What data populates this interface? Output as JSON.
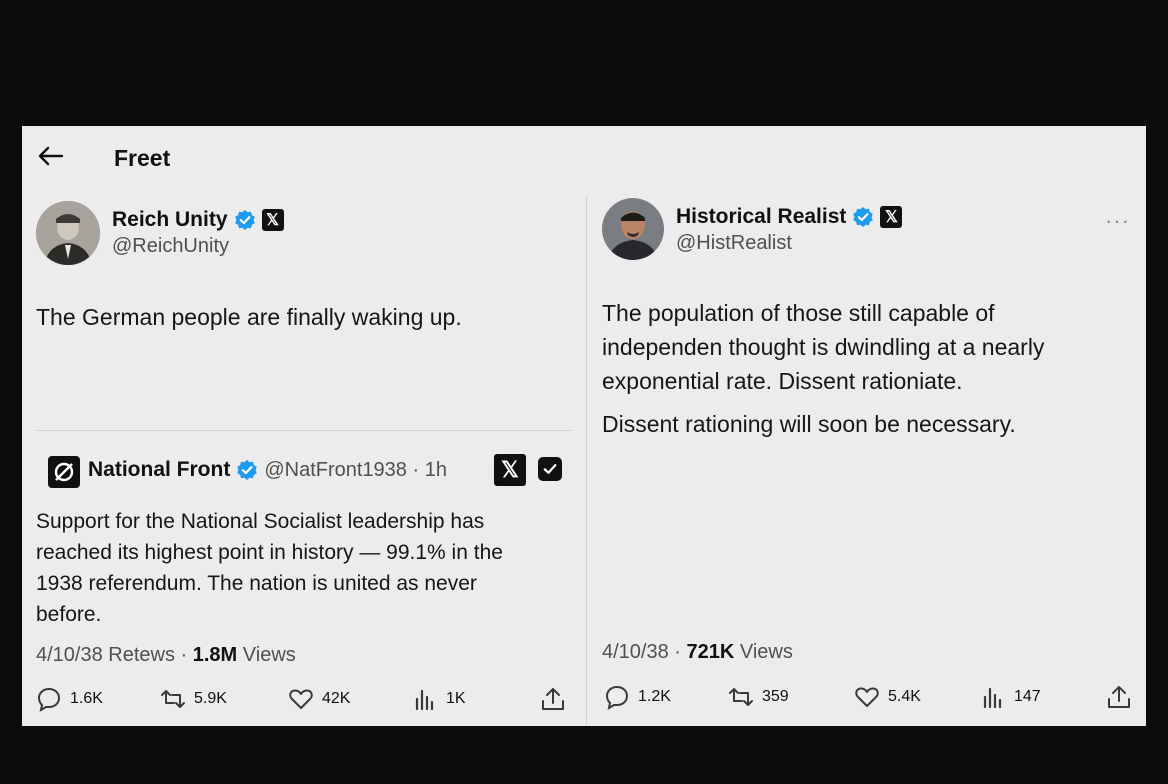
{
  "header": {
    "title": "Freet"
  },
  "left_post": {
    "author_name": "Reich Unity",
    "author_handle": "@ReichUnity",
    "text": "The German people are finally waking up.",
    "quote": {
      "author_name": "National Front",
      "author_handle": "@NatFront1938 · 1h",
      "text_lines": [
        "Support for the National Socialist leadership has",
        "reached its highest point in history — 99.1% in the",
        "1938 referendum. The nation is united as never",
        "before."
      ]
    },
    "meta_prefix": "4/10/38 Retews · ",
    "meta_views_count": "1.8M",
    "meta_views_label": " Views",
    "actions": {
      "replies": "1.6K",
      "reposts": "5.9K",
      "likes": "42K",
      "views": "1K"
    }
  },
  "right_post": {
    "author_name": "Historical Realist",
    "author_handle": "@HistRealist",
    "more_label": "···",
    "text_lines": [
      "The population of those still capable of",
      "independen thought is dwindling at a nearly",
      "exponential rate. Dissent rationiate."
    ],
    "text_2": "Dissent rationing will soon be necessary.",
    "meta_prefix": "4/10/38 · ",
    "meta_views_count": "721K",
    "meta_views_label": " Views",
    "actions": {
      "replies": "1.2K",
      "reposts": "359",
      "likes": "5.4K",
      "views": "147"
    }
  },
  "colors": {
    "verified": "#1d9bf0",
    "screen_bg": "#ececec",
    "frame_bg": "#0b0b0c"
  }
}
